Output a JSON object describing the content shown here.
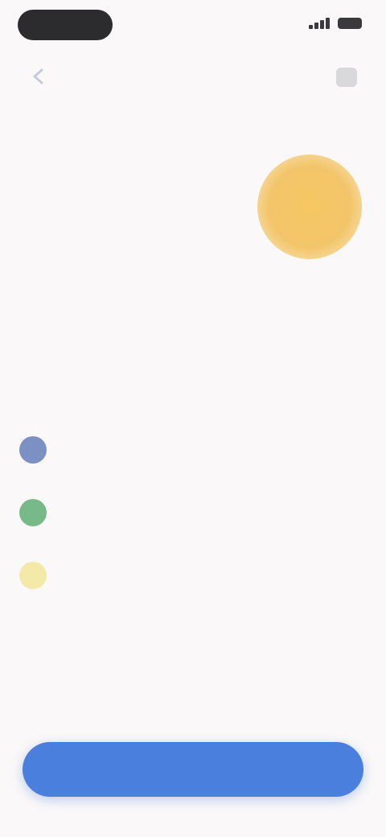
{
  "status_bar": {
    "time": "",
    "signal_icon": "signal-icon",
    "battery_icon": "battery-icon"
  },
  "nav": {
    "back_icon": "chevron-left-icon",
    "link_label": "",
    "menu_icon": "menu-icon"
  },
  "product": {
    "name": "",
    "illustration_icon": "sun-icon"
  },
  "main": {
    "headline": "",
    "subtext": ""
  },
  "features": [
    {
      "icon": "feature-icon-blue",
      "color": "#7d90c4",
      "text": ""
    },
    {
      "icon": "feature-icon-green",
      "color": "#78b98a",
      "text": ""
    },
    {
      "icon": "feature-icon-yellow",
      "color": "#f3e9a8",
      "text": ""
    }
  ],
  "cta": {
    "label": "",
    "color": "#4a7fdd"
  },
  "colors": {
    "background": "#faf8f8",
    "accent": "#1a73e8",
    "sun": "#f3c56a"
  }
}
